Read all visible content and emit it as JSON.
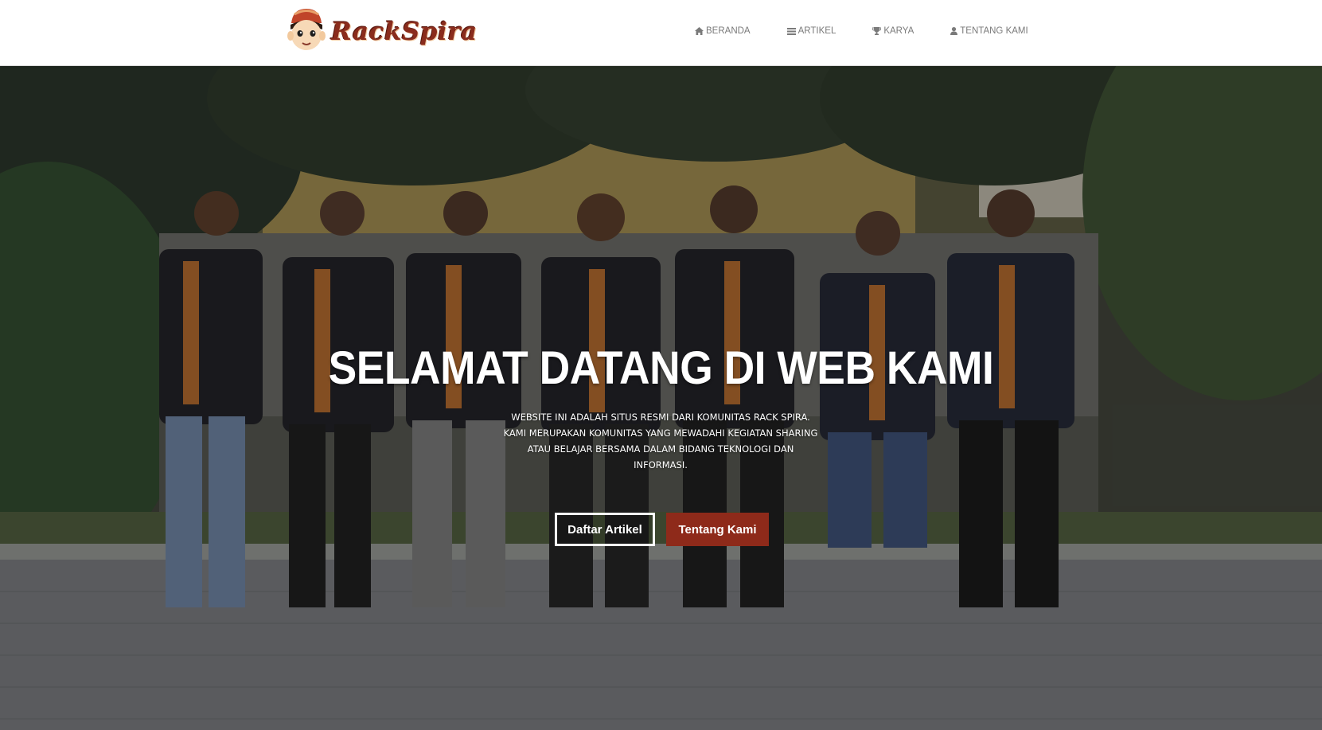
{
  "brand": {
    "name": "RackSpira",
    "logo_icon": "mascot-face-icon",
    "accent_color": "#8e2a1a"
  },
  "nav": {
    "items": [
      {
        "label": "BERANDA",
        "icon": "home-icon"
      },
      {
        "label": "ARTIKEL",
        "icon": "list-icon"
      },
      {
        "label": "KARYA",
        "icon": "trophy-icon"
      },
      {
        "label": "TENTANG KAMI",
        "icon": "user-icon"
      }
    ]
  },
  "hero": {
    "title": "SELAMAT DATANG DI WEB KAMI",
    "description": "WEBSITE INI ADALAH SITUS RESMI DARI KOMUNITAS RACK SPIRA. KAMI MERUPAKAN KOMUNITAS YANG MEWADAHI KEGIATAN SHARING ATAU BELAJAR BERSAMA DALAM BIDANG TEKNOLOGI DAN INFORMASI.",
    "buttons": {
      "primary_label": "Daftar Artikel",
      "secondary_label": "Tentang Kami"
    }
  }
}
